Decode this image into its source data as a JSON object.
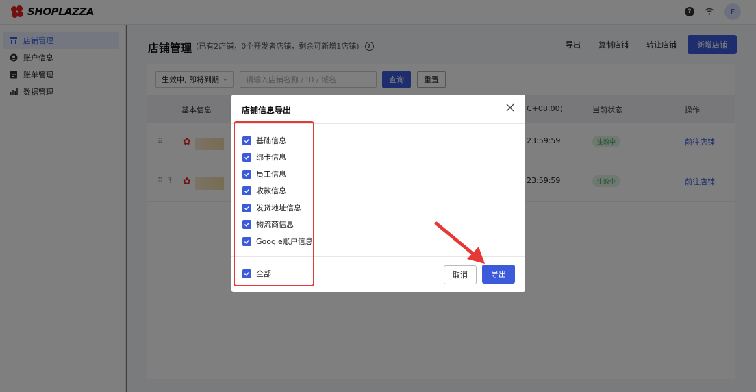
{
  "brand": {
    "name": "SHOPLAZZA",
    "color": "#e02020"
  },
  "topbar": {
    "help_icon": "?",
    "avatar_initial": "F"
  },
  "sidebar": {
    "items": [
      {
        "label": "店铺管理",
        "icon": "store-icon",
        "active": true
      },
      {
        "label": "账户信息",
        "icon": "user-icon",
        "active": false
      },
      {
        "label": "账单管理",
        "icon": "bill-icon",
        "active": false
      },
      {
        "label": "数据管理",
        "icon": "chart-icon",
        "active": false
      }
    ]
  },
  "header": {
    "title": "店铺管理",
    "subtitle": "(已有2店铺，0个开发者店铺，剩余可新增1店铺)",
    "actions": {
      "export": "导出",
      "copy_store": "复制店铺",
      "transfer_store": "转让店铺",
      "new_store": "新增店铺"
    }
  },
  "filters": {
    "status_value": "生效中, 即将到期",
    "search_placeholder": "请输入店铺名称 / ID / 域名",
    "query_label": "查询",
    "reset_label": "重置"
  },
  "table": {
    "columns": {
      "basic_info": "基本信息",
      "expiry": "C+08:00)",
      "status": "当前状态",
      "actions": "操作"
    },
    "rows": [
      {
        "expiry": "23:59:59",
        "status": "生效中",
        "action": "前往店铺"
      },
      {
        "expiry": "23:59:59",
        "status": "生效中",
        "action": "前往店铺"
      }
    ]
  },
  "modal": {
    "title": "店铺信息导出",
    "options": [
      {
        "label": "基础信息",
        "checked": true
      },
      {
        "label": "绑卡信息",
        "checked": true
      },
      {
        "label": "员工信息",
        "checked": true
      },
      {
        "label": "收款信息",
        "checked": true
      },
      {
        "label": "发货地址信息",
        "checked": true
      },
      {
        "label": "物流商信息",
        "checked": true
      },
      {
        "label": "Google账户信息",
        "checked": true
      }
    ],
    "select_all": {
      "label": "全部",
      "checked": true
    },
    "cancel_label": "取消",
    "export_label": "导出"
  },
  "colors": {
    "primary": "#3b5bdb",
    "annotation": "#e53935",
    "success": "#2e9a4e"
  }
}
